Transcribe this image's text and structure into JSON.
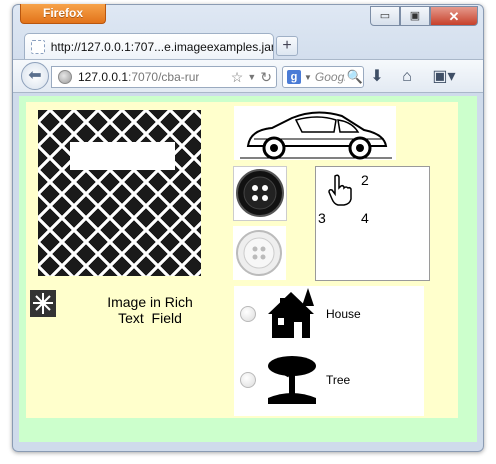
{
  "browser": {
    "app_button": "Firefox",
    "tab_title": "http://127.0.0.1:707...e.imageexamples.jar/",
    "new_tab_label": "+",
    "url_host": "127.0.0.1",
    "url_rest": ":7070/cba-rur",
    "search_placeholder": "Googl",
    "window_controls": {
      "minimize": "▭",
      "maximize": "▣",
      "close": "✕"
    },
    "icons": {
      "back": "arrow-left-icon",
      "bookmark": "star-icon",
      "reload": "reload-icon",
      "download": "download-arrow-icon",
      "home": "home-icon",
      "bookmarks_menu": "bookmarks-menu-icon"
    }
  },
  "page": {
    "cursor_labels": {
      "two": "2",
      "three": "3",
      "four": "4"
    },
    "rich_text": {
      "line1": "Image in Rich",
      "line2": "Text  Field"
    },
    "radio_options": [
      {
        "label": "House",
        "selected": false
      },
      {
        "label": "Tree",
        "selected": false
      }
    ],
    "colors": {
      "page_bg": "#ccffcc",
      "panel_bg": "#ffffcc",
      "firefox_orange": "#e2731a"
    }
  }
}
